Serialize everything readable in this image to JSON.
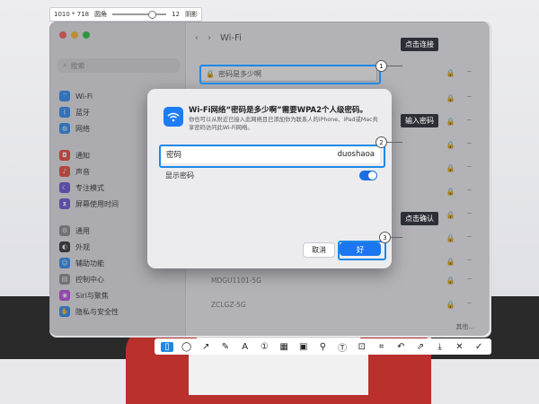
{
  "capture": {
    "size_text": "1010 * 718",
    "mode_label": "圆角",
    "radius_value": "12",
    "shadow_label": "阴影"
  },
  "sidebar": {
    "search_placeholder": "搜索",
    "items": [
      {
        "label": "Wi-Fi",
        "icon": "wifi-icon",
        "color": "#2f8ef5"
      },
      {
        "label": "蓝牙",
        "icon": "bluetooth-icon",
        "color": "#2f8ef5"
      },
      {
        "label": "网络",
        "icon": "globe-icon",
        "color": "#2f8ef5"
      },
      {
        "label": "通知",
        "icon": "bell-icon",
        "color": "#f04a3a"
      },
      {
        "label": "声音",
        "icon": "speaker-icon",
        "color": "#f04a3a"
      },
      {
        "label": "专注模式",
        "icon": "moon-icon",
        "color": "#6e57d6"
      },
      {
        "label": "屏幕使用时间",
        "icon": "hourglass-icon",
        "color": "#6e57d6"
      },
      {
        "label": "通用",
        "icon": "gear-icon",
        "color": "#8e8e93"
      },
      {
        "label": "外观",
        "icon": "appearance-icon",
        "color": "#333333"
      },
      {
        "label": "辅助功能",
        "icon": "accessibility-icon",
        "color": "#2f8ef5"
      },
      {
        "label": "控制中心",
        "icon": "control-center-icon",
        "color": "#8e8e93"
      },
      {
        "label": "Siri与聚焦",
        "icon": "siri-icon",
        "color": "#c04ae0"
      },
      {
        "label": "隐私与安全性",
        "icon": "hand-icon",
        "color": "#2f8ef5"
      }
    ]
  },
  "main": {
    "title": "Wi-Fi",
    "network_field": "密码是多少啊",
    "networks": [
      "MDGU1101-5G",
      "ZCLGZ-5G"
    ],
    "other_button": "其他..."
  },
  "dialog": {
    "title": "Wi-Fi网络“密码是多少啊”需要WPA2个人级密码。",
    "description": "你也可以从附近已接入此网络且已添加你为联系人的iPhone、iPad或Mac共享密码访问此Wi-Fi网络。",
    "password_label": "密码",
    "password_value": "duoshaoa",
    "show_password_label": "显示密码",
    "show_password_on": true,
    "cancel_label": "取消",
    "ok_label": "好"
  },
  "callouts": [
    {
      "number": "1",
      "text": "点击连接"
    },
    {
      "number": "2",
      "text": "输入密码"
    },
    {
      "number": "3",
      "text": "点击确认"
    }
  ],
  "toolbar": {
    "tools": [
      "rect-tool-icon",
      "ellipse-tool-icon",
      "arrow-tool-icon",
      "pen-tool-icon",
      "text-tool-icon",
      "number-tool-icon",
      "mosaic-tool-icon",
      "blur-tool-icon",
      "pin-tool-icon",
      "ocr-tool-icon",
      "long-capture-icon",
      "scan-tool-icon",
      "undo-icon",
      "share-icon",
      "download-icon",
      "close-icon",
      "confirm-icon"
    ]
  }
}
